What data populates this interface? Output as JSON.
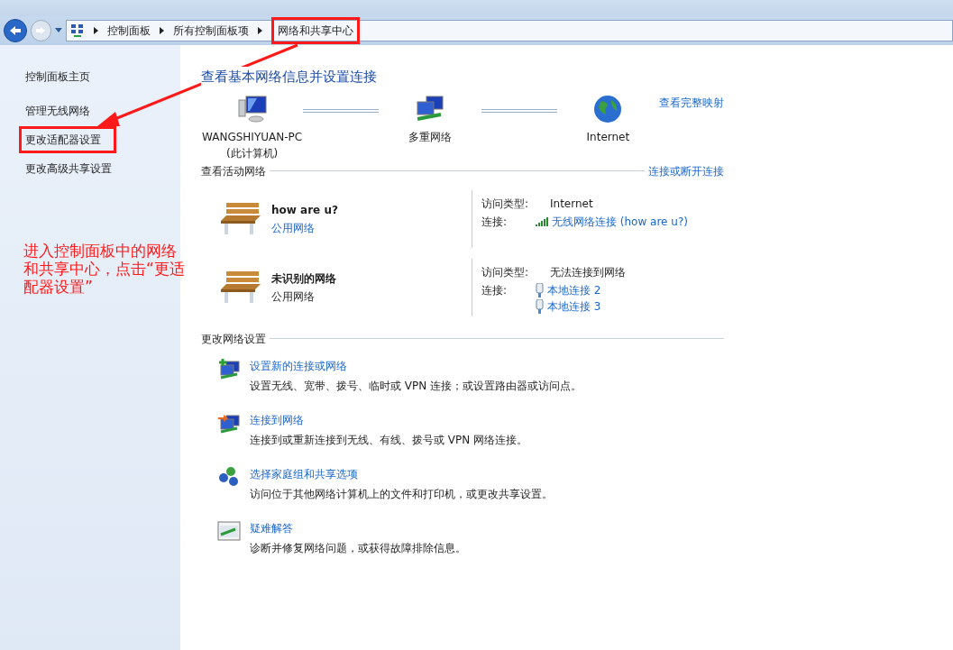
{
  "breadcrumb": [
    {
      "label": "控制面板",
      "highlighted": false
    },
    {
      "label": "所有控制面板项",
      "highlighted": false
    },
    {
      "label": "网络和共享中心",
      "highlighted": true
    }
  ],
  "sidebar": {
    "items": [
      {
        "label": "控制面板主页",
        "highlighted": false
      },
      {
        "label": "管理无线网络",
        "highlighted": false
      },
      {
        "label": "更改适配器设置",
        "highlighted": true
      },
      {
        "label": "更改高级共享设置",
        "highlighted": false
      }
    ]
  },
  "annotation": {
    "text": "进入控制面板中的网络和共享中心，点击“更适配器设置”"
  },
  "main": {
    "title": "查看基本网络信息并设置连接",
    "map_link": "查看完整映射",
    "map_nodes": [
      {
        "kind": "computer",
        "label": "WANGSHIYUAN-PC",
        "sublabel": "(此计算机)"
      },
      {
        "kind": "network",
        "label": "多重网络"
      },
      {
        "kind": "globe",
        "label": "Internet"
      }
    ],
    "active_header": "查看活动网络",
    "active_link": "连接或断开连接",
    "networks": [
      {
        "name": "how are u?",
        "type": "公用网络",
        "type_is_link": true,
        "access_label": "访问类型:",
        "access": "Internet",
        "connections_label": "连接:",
        "connections": [
          {
            "kind": "wifi",
            "label": "无线网络连接 (how are u?)"
          }
        ]
      },
      {
        "name": "未识别的网络",
        "type": "公用网络",
        "type_is_link": false,
        "access_label": "访问类型:",
        "access": "无法连接到网络",
        "connections_label": "连接:",
        "connections": [
          {
            "kind": "ethernet",
            "label": "本地连接 2"
          },
          {
            "kind": "ethernet",
            "label": "本地连接 3"
          }
        ]
      }
    ],
    "settings_header": "更改网络设置",
    "tasks": [
      {
        "kind": "new",
        "title": "设置新的连接或网络",
        "description": "设置无线、宽带、拨号、临时或 VPN 连接；或设置路由器或访问点。"
      },
      {
        "kind": "connect",
        "title": "连接到网络",
        "description": "连接到或重新连接到无线、有线、拨号或 VPN 网络连接。"
      },
      {
        "kind": "homegroup",
        "title": "选择家庭组和共享选项",
        "description": "访问位于其他网络计算机上的文件和打印机，或更改共享设置。"
      },
      {
        "kind": "troubleshoot",
        "title": "疑难解答",
        "description": "诊断并修复网络问题，或获得故障排除信息。"
      }
    ]
  }
}
